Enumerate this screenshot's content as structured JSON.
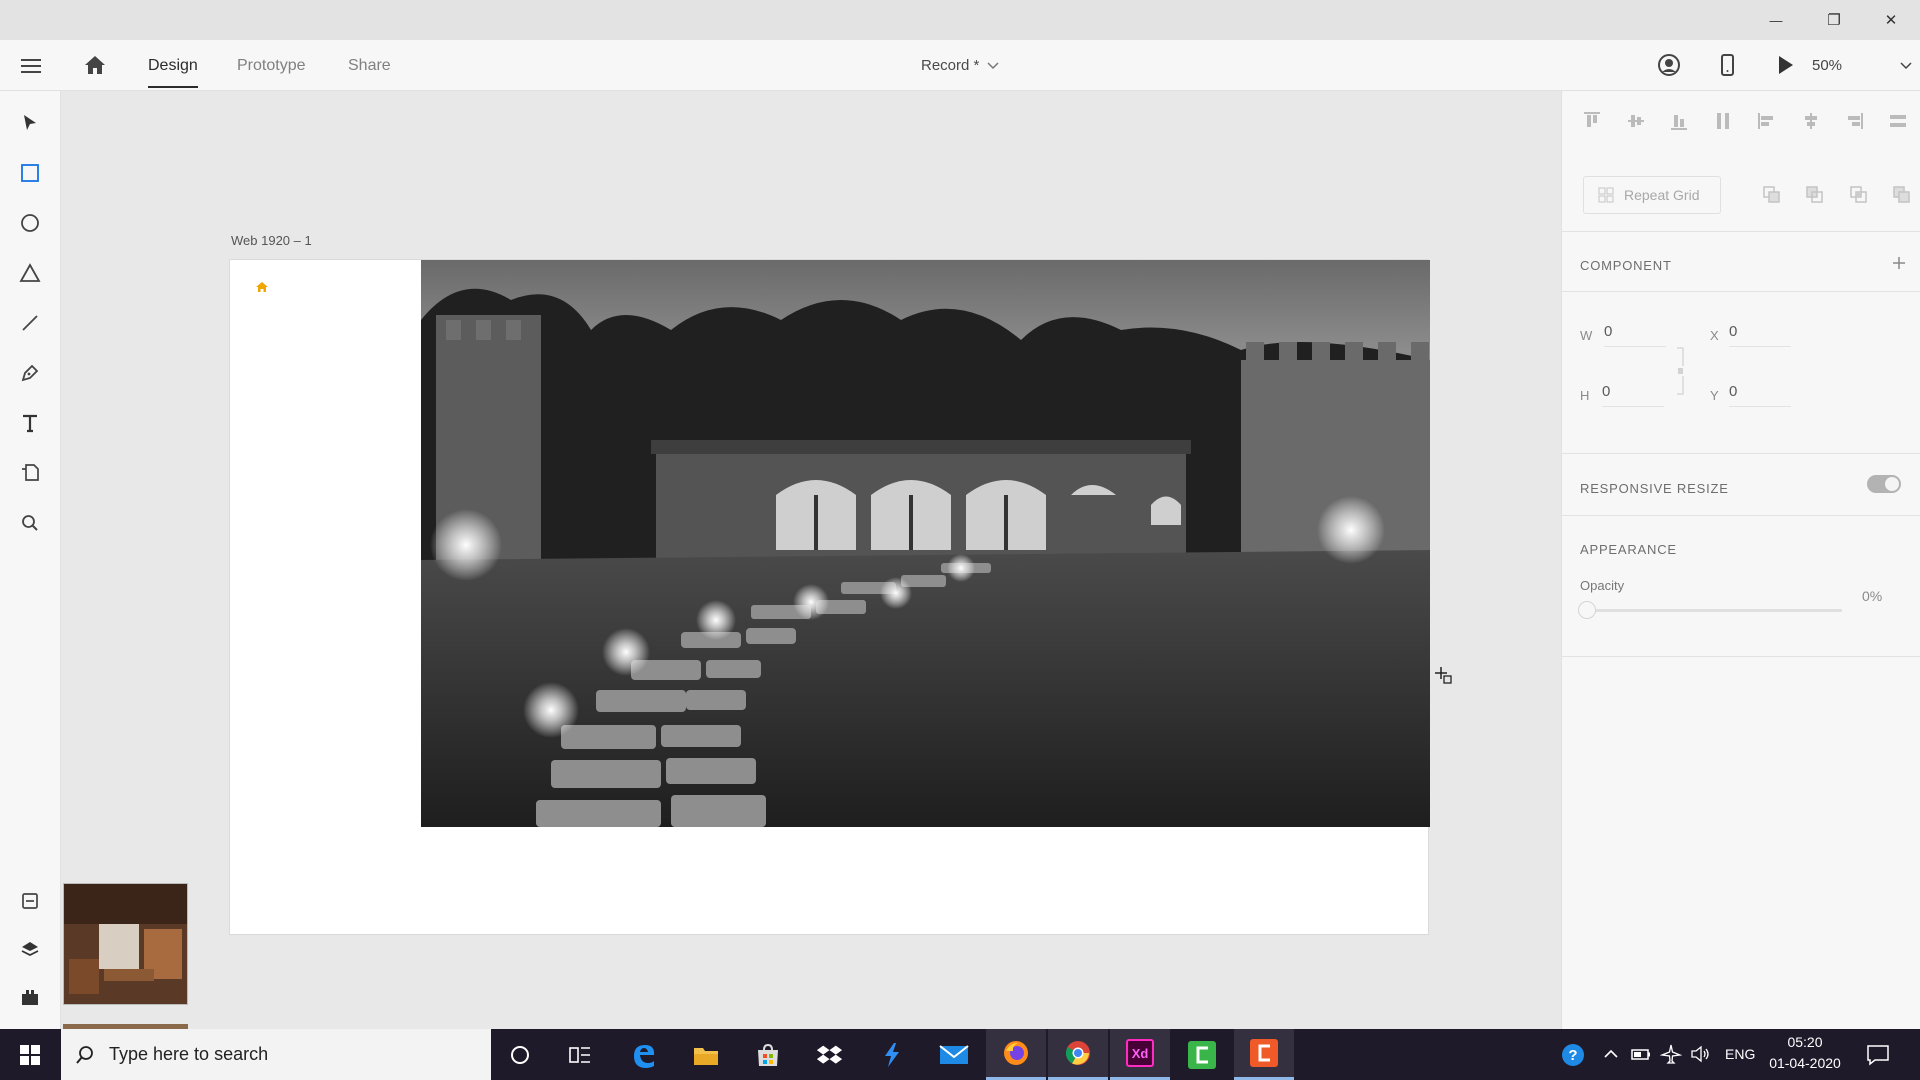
{
  "window": {
    "minimize_glyph": "—",
    "maximize_glyph": "❐",
    "close_glyph": "✕"
  },
  "appbar": {
    "tabs": [
      {
        "label": "Design"
      },
      {
        "label": "Prototype"
      },
      {
        "label": "Share"
      }
    ],
    "document_title": "Record *",
    "zoom": "50%"
  },
  "canvas": {
    "artboard_label": "Web 1920 – 1"
  },
  "right_panel": {
    "repeat_grid_label": "Repeat Grid",
    "component_heading": "COMPONENT",
    "w_label": "W",
    "w_value": "0",
    "h_label": "H",
    "h_value": "0",
    "x_label": "X",
    "x_value": "0",
    "y_label": "Y",
    "y_value": "0",
    "responsive_heading": "RESPONSIVE RESIZE",
    "responsive_on": true,
    "appearance_heading": "APPEARANCE",
    "opacity_label": "Opacity",
    "opacity_value": "0%",
    "opacity_level": 0
  },
  "taskbar": {
    "search_placeholder": "Type here to search",
    "language": "ENG",
    "time": "05:20",
    "date": "01-04-2020"
  },
  "colors": {
    "accent_home": "#f0a500",
    "taskbar_bg": "#1e1a2a",
    "xd_pink": "#ff2bc2"
  }
}
